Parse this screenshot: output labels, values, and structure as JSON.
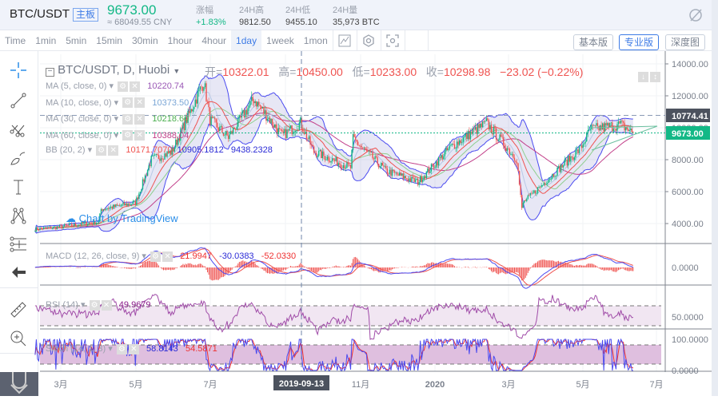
{
  "header": {
    "pair": "BTC/USDT",
    "board": "主板",
    "last_price": "9673.00",
    "cny": "≈ 68049.55 CNY",
    "stats": [
      {
        "label": "涨幅",
        "value": "+1.83%"
      },
      {
        "label": "24H高",
        "value": "9812.50"
      },
      {
        "label": "24H低",
        "value": "9455.10"
      },
      {
        "label": "24H量",
        "value": "35,973 BTC"
      }
    ]
  },
  "toolbar": {
    "timeframes": [
      "Time",
      "1min",
      "5min",
      "15min",
      "30min",
      "1hour",
      "4hour",
      "1day",
      "1week",
      "1mon"
    ],
    "active": "1day",
    "versions": [
      "基本版",
      "专业版",
      "深度图"
    ],
    "active_version": "专业版"
  },
  "legend": {
    "title": "BTC/USDT, D, Huobi",
    "open_label": "开=",
    "open": "10322.01",
    "high_label": "高=",
    "high": "10450.00",
    "low_label": "低=",
    "low": "10233.00",
    "close_label": "收=",
    "close": "10298.98",
    "change": "−23.02 (−0.22%)",
    "ma": [
      {
        "label": "MA (5, close, 0)",
        "value": "10220.74",
        "color": "#9b59b6"
      },
      {
        "label": "MA (10, close, 0)",
        "value": "10373.50",
        "color": "#7aa6d6"
      },
      {
        "label": "MA (30, close, 0)",
        "value": "10218.60",
        "color": "#4caf50"
      },
      {
        "label": "MA (60, close, 0)",
        "value": "10388.04",
        "color": "#c2408a"
      }
    ],
    "bb": {
      "label": "BB (20, 2)",
      "mid": "10171.7070",
      "upper": "10905.1812",
      "lower": "9438.2328"
    },
    "macd": {
      "label": "MACD (12, 26, close, 9)",
      "hist": "21.9947",
      "macd": "-30.0383",
      "signal": "-52.0330"
    },
    "rsi": {
      "label": "RSI (14)",
      "value": "49.9679"
    },
    "stoch": {
      "label": "Stoch (14, 1, 3)",
      "k": "58.8143",
      "d": "54.5871"
    }
  },
  "watermark": "Chart by TradingView",
  "price_axis": {
    "ticks": [
      "14000.00",
      "12000.00",
      "10000.00",
      "8000.00",
      "6000.00",
      "4000.00"
    ],
    "crosshair_price": "10774.41",
    "last_price": "9673.00"
  },
  "macd_axis": [
    "0.0000"
  ],
  "rsi_axis": [
    "50.0000"
  ],
  "stoch_axis": [
    "100.0000",
    "0.0000"
  ],
  "time_axis": {
    "ticks": [
      "3月",
      "5月",
      "7月",
      "11月",
      "2020",
      "3月",
      "5月",
      "7月"
    ],
    "crosshair_date": "2019-09-13"
  },
  "colors": {
    "up": "#13b886",
    "down": "#ef5350",
    "accent": "#3d7be6"
  },
  "chart_data": {
    "type": "candlestick",
    "ylim": [
      3000,
      14500
    ],
    "close_keypoints": [
      [
        "2019-02-08",
        3650
      ],
      [
        "2019-03-01",
        3800
      ],
      [
        "2019-04-01",
        4100
      ],
      [
        "2019-04-03",
        4900
      ],
      [
        "2019-05-01",
        5300
      ],
      [
        "2019-05-14",
        8000
      ],
      [
        "2019-05-31",
        8500
      ],
      [
        "2019-06-26",
        12900
      ],
      [
        "2019-07-01",
        10500
      ],
      [
        "2019-07-16",
        9400
      ],
      [
        "2019-08-06",
        11800
      ],
      [
        "2019-08-29",
        9500
      ],
      [
        "2019-09-13",
        10300
      ],
      [
        "2019-09-24",
        8500
      ],
      [
        "2019-10-24",
        7500
      ],
      [
        "2019-10-26",
        9300
      ],
      [
        "2019-11-22",
        7300
      ],
      [
        "2019-12-18",
        6600
      ],
      [
        "2020-01-14",
        8800
      ],
      [
        "2020-02-12",
        10300
      ],
      [
        "2020-03-08",
        8000
      ],
      [
        "2020-03-12",
        4900
      ],
      [
        "2020-03-13",
        5300
      ],
      [
        "2020-04-29",
        8700
      ],
      [
        "2020-05-07",
        9900
      ],
      [
        "2020-06-01",
        10200
      ],
      [
        "2020-06-11",
        9673
      ]
    ]
  }
}
